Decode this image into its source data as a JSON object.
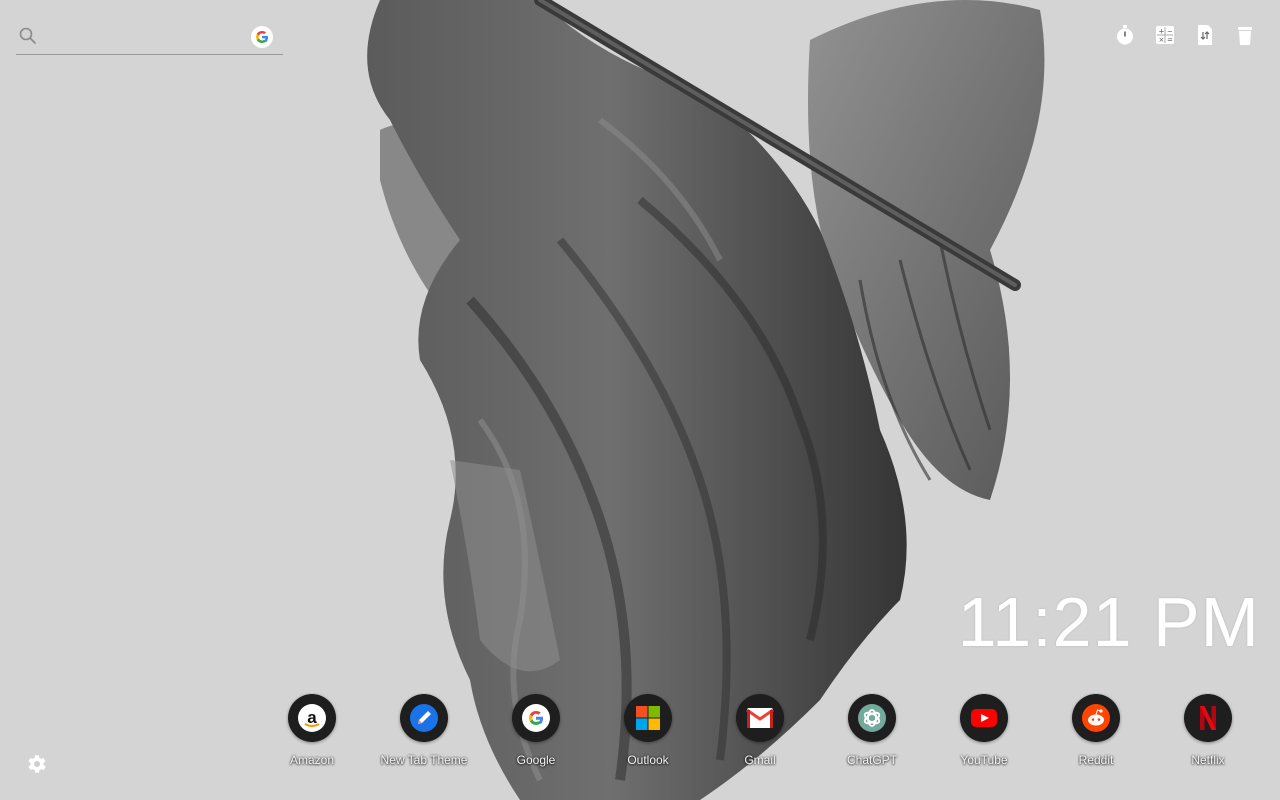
{
  "search": {
    "placeholder": "",
    "engine_icon": "google-g-icon"
  },
  "tools": [
    {
      "name": "timer-icon"
    },
    {
      "name": "calculator-icon"
    },
    {
      "name": "file-transfer-icon"
    },
    {
      "name": "trash-icon"
    }
  ],
  "clock": {
    "time": "11:21 PM"
  },
  "dock": {
    "items": [
      {
        "label": "Amazon",
        "icon": "amazon-icon",
        "color": "#ffffff"
      },
      {
        "label": "New Tab Theme",
        "icon": "pencil-icon",
        "color": "#1a73e8"
      },
      {
        "label": "Google",
        "icon": "google-icon",
        "color": "#ffffff"
      },
      {
        "label": "Outlook",
        "icon": "microsoft-icon",
        "color": "#f25022"
      },
      {
        "label": "Gmail",
        "icon": "gmail-icon",
        "color": "#ea4335"
      },
      {
        "label": "ChatGPT",
        "icon": "chatgpt-icon",
        "color": "#74aa9c"
      },
      {
        "label": "YouTube",
        "icon": "youtube-icon",
        "color": "#ff0000"
      },
      {
        "label": "Reddit",
        "icon": "reddit-icon",
        "color": "#ff4500"
      },
      {
        "label": "Netflix",
        "icon": "netflix-icon",
        "color": "#e50914"
      }
    ]
  },
  "settings": {
    "icon": "gear-icon"
  },
  "background": {
    "subject": "angel-statue-photo"
  }
}
